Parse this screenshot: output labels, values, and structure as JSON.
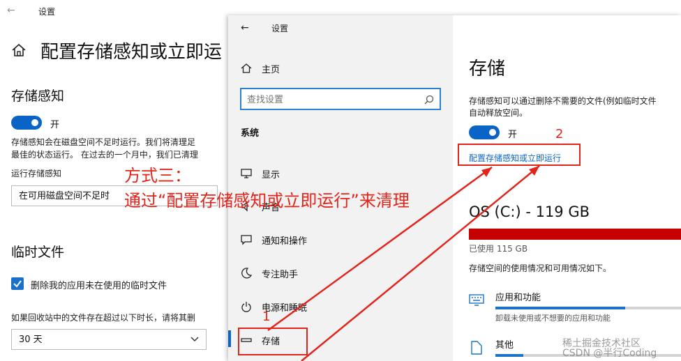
{
  "back_window": {
    "title": "设置",
    "heading": "配置存储感知或立即运",
    "storage_sense": {
      "heading": "存储感知",
      "toggle_label": "开",
      "desc_line1": "存储感知会在磁盘空间不足时运行。我们将清理足",
      "desc_line2": "最佳的状态运行。 在过去的一个月中，我们已清理",
      "run_label": "运行存储感知",
      "run_value": "在可用磁盘空间不足时"
    },
    "temp_files": {
      "heading": "临时文件",
      "checkbox_label": "删除我的应用未在使用的临时文件",
      "recycle_label": "如果回收站中的文件存在超过以下时长，请将其删",
      "recycle_value": "30 天"
    }
  },
  "front_window": {
    "title": "设置",
    "home": "主页",
    "search_placeholder": "查找设置",
    "category": "系统",
    "nav": [
      {
        "label": "显示",
        "icon": "monitor-icon"
      },
      {
        "label": "声音",
        "icon": "speaker-icon"
      },
      {
        "label": "通知和操作",
        "icon": "notification-icon"
      },
      {
        "label": "专注助手",
        "icon": "moon-icon"
      },
      {
        "label": "电源和睡眠",
        "icon": "power-icon"
      },
      {
        "label": "存储",
        "icon": "storage-icon"
      }
    ],
    "storage": {
      "heading": "存储",
      "desc_line1": "存储感知可以通过删除不需要的文件(例如临时文件",
      "desc_line2": "自动释放空间。",
      "toggle_label": "开",
      "configure_link": "配置存储感知或立即运行",
      "drive_title": "OS (C:) - 119 GB",
      "used": "已使用 115 GB",
      "usage_info": "存储空间的使用情况和可用情况如下。",
      "categories": [
        {
          "name": "应用和功能",
          "desc": "卸载未使用或不想要的应用和功能",
          "fill": 0.7
        },
        {
          "name": "其他",
          "desc": "",
          "fill": 0.15
        }
      ]
    }
  },
  "annotations": {
    "method": "方式三：",
    "method_desc": "通过“配置存储感知或立即运行”来清理",
    "num1": "1",
    "num2": "2",
    "watermark": "CSDN @半行Coding",
    "watermark2": "稀土掘金技术社区"
  },
  "colors": {
    "accent": "#0a64c8",
    "annotation_red": "#e3241b",
    "storage_bar": "#c40000"
  }
}
